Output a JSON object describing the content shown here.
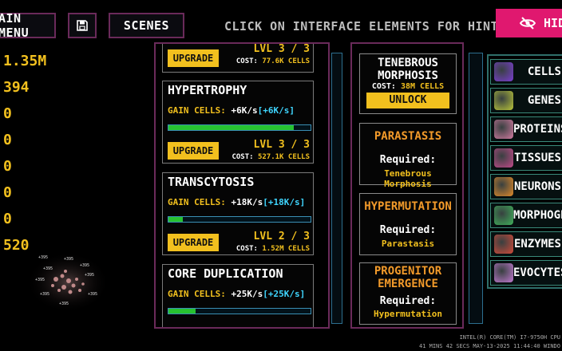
{
  "top": {
    "main_menu": "AIN MENU",
    "scenes": "SCENES",
    "hint": "CLICK ON INTERFACE ELEMENTS FOR HINTS",
    "hide": "HIDE"
  },
  "resources": [
    "1.35M",
    "394",
    "0",
    "0",
    "0",
    "0",
    "0",
    "520"
  ],
  "upgrades": {
    "top_partial": {
      "button": "UPGRADE",
      "level": "LVL 3 / 3",
      "cost_label": "COST:",
      "cost": "77.6K CELLS"
    },
    "items": [
      {
        "title": "HYPERTROPHY",
        "gain_label": "GAIN CELLS:",
        "gain": "+6K/s",
        "rate": "[+6K/s]",
        "progress": 0.88,
        "button": "UPGRADE",
        "level": "LVL 3 / 3",
        "cost_label": "COST:",
        "cost": "527.1K CELLS"
      },
      {
        "title": "TRANSCYTOSIS",
        "gain_label": "GAIN CELLS:",
        "gain": "+18K/s",
        "rate": "[+18K/s]",
        "progress": 0.1,
        "button": "UPGRADE",
        "level": "LVL 2 / 3",
        "cost_label": "COST:",
        "cost": "1.52M CELLS"
      },
      {
        "title": "CORE DUPLICATION",
        "gain_label": "GAIN CELLS:",
        "gain": "+25K/s",
        "rate": "[+25K/s]",
        "progress": 0.19
      }
    ]
  },
  "mutations": {
    "featured": {
      "title_line1": "TENEBROUS",
      "title_line2": "MORPHOSIS",
      "cost_label": "COST:",
      "cost": "38M CELLS",
      "button": "UNLOCK"
    },
    "locked": [
      {
        "title_line1": "PARASTASIS",
        "title_line2": "",
        "required_label": "Required:",
        "required": "Tenebrous Morphosis"
      },
      {
        "title_line1": "HYPERMUTATION",
        "title_line2": "",
        "required_label": "Required:",
        "required": "Parastasis"
      },
      {
        "title_line1": "PROGENITOR",
        "title_line2": "EMERGENCE",
        "required_label": "Required:",
        "required": "Hypermutation"
      }
    ]
  },
  "categories": [
    {
      "name": "CELLS",
      "icon": "cell-icon",
      "color": "#7a3fd0"
    },
    {
      "name": "GENES",
      "icon": "gene-icon",
      "color": "#b8c43a"
    },
    {
      "name": "PROTEINS",
      "icon": "protein-icon",
      "color": "#d07aa0"
    },
    {
      "name": "TISSUES",
      "icon": "tissue-icon",
      "color": "#c04a8a"
    },
    {
      "name": "NEURONS",
      "icon": "neuron-icon",
      "color": "#e08a2a"
    },
    {
      "name": "MORPHOGENS",
      "icon": "morphogen-icon",
      "color": "#3fb05a"
    },
    {
      "name": "ENZYMES",
      "icon": "enzyme-icon",
      "color": "#d04a3a"
    },
    {
      "name": "EVOCYTES",
      "icon": "evocyte-icon",
      "color": "#c07ad0"
    }
  ],
  "sysinfo": {
    "line1": "INTEL(R) CORE(TM) I7-9750H CPU",
    "line2": "41 MINS 42 SECS   MAY-13-2025 11:44:40   WINDO"
  }
}
